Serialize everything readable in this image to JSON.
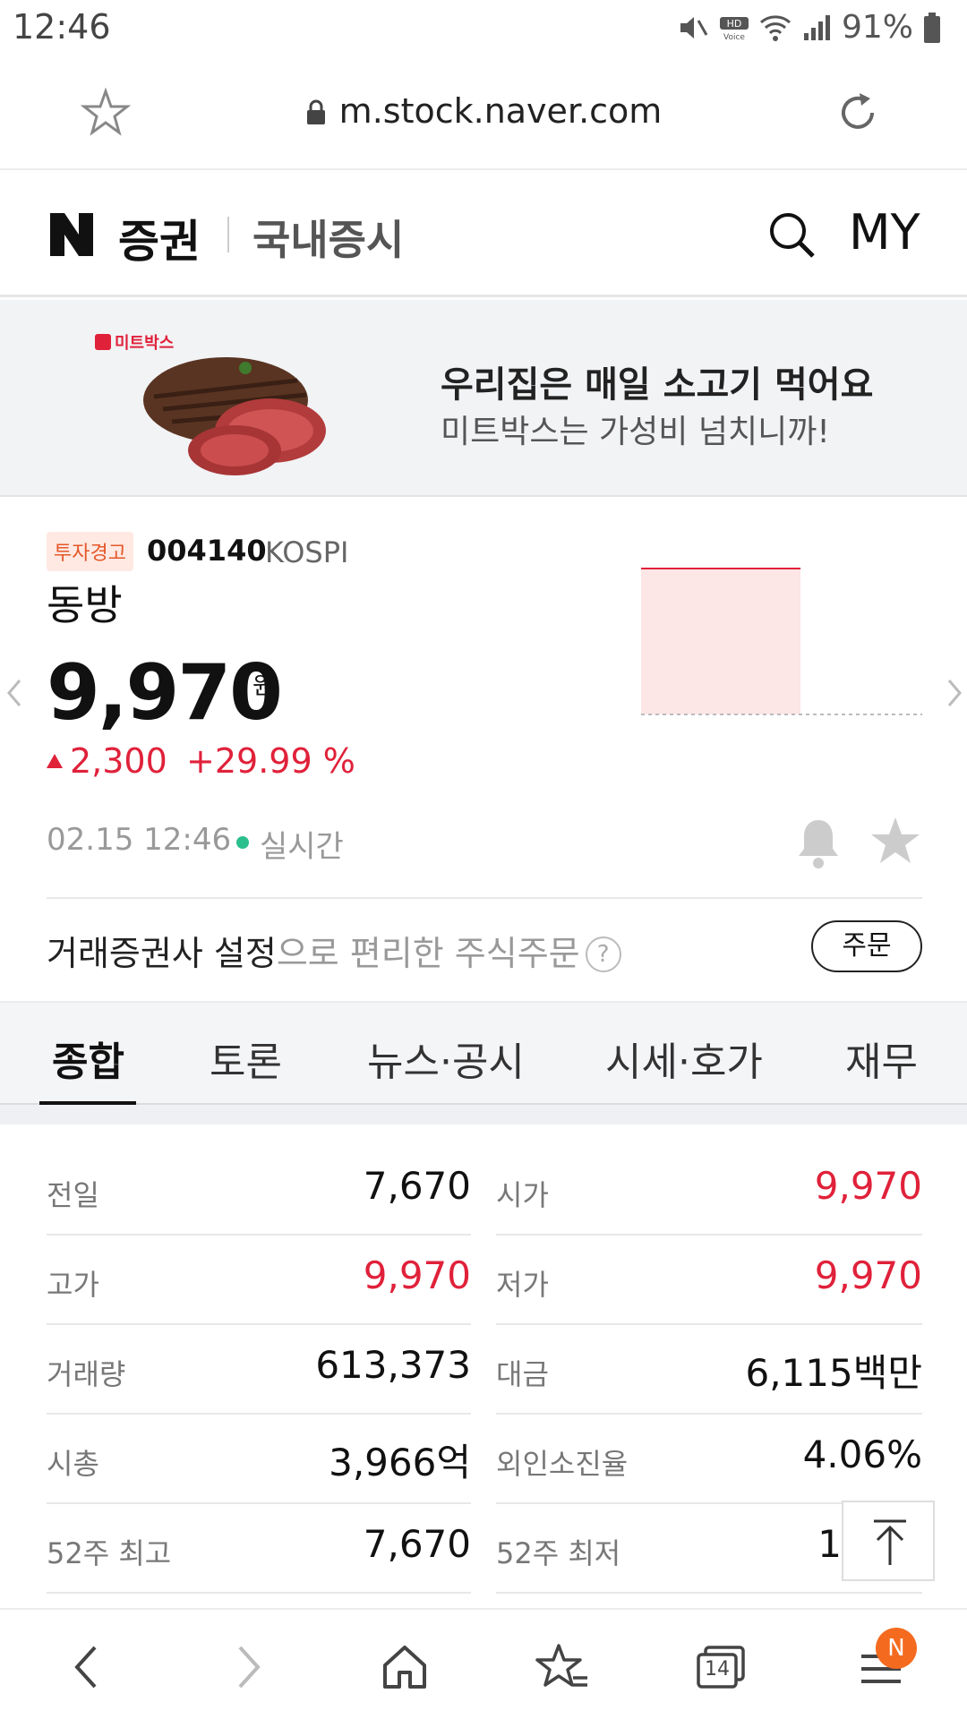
{
  "status_bar": {
    "time": "12:46",
    "battery": "91%"
  },
  "browser": {
    "url": "m.stock.naver.com"
  },
  "header": {
    "brand": "증권",
    "section": "국내증시",
    "my_label": "MY"
  },
  "ad": {
    "logo_text": "미트박스",
    "title": "우리집은 매일 소고기 먹어요",
    "subtitle": "미트박스는 가성비 넘치니까!"
  },
  "stock": {
    "warning_badge": "투자경고",
    "code": "004140",
    "market": "KOSPI",
    "name": "동방",
    "price": "9,970",
    "unit": "원",
    "change": "2,300",
    "change_pct": "+29.99 %",
    "datetime": "02.15 12:46",
    "realtime_label": "실시간"
  },
  "order": {
    "prompt_bold": "거래증권사 설정",
    "prompt_rest": "으로 편리한 주식주문",
    "help": "?",
    "button": "주문"
  },
  "tabs": [
    "종합",
    "토론",
    "뉴스·공시",
    "시세·호가",
    "재무"
  ],
  "summary": {
    "rows": [
      {
        "l_label": "전일",
        "l_value": "7,670",
        "r_label": "시가",
        "r_value": "9,970"
      },
      {
        "l_label": "고가",
        "l_value": "9,970",
        "r_label": "저가",
        "r_value": "9,970"
      },
      {
        "l_label": "거래량",
        "l_value": "613,373",
        "r_label": "대금",
        "r_value": "6,115백만"
      },
      {
        "l_label": "시총",
        "l_value": "3,966억",
        "r_label": "외인소진율",
        "r_value": "4.06%"
      },
      {
        "l_label": "52주 최고",
        "l_value": "7,670",
        "r_label": "52주 최저",
        "r_value": "1"
      }
    ]
  },
  "bottom_nav": {
    "tabs_count": "14",
    "menu_badge": "N"
  },
  "colors": {
    "up_red": "#e0213a",
    "realtime_green": "#2cbf8e",
    "badge_orange": "#f46a1e"
  }
}
